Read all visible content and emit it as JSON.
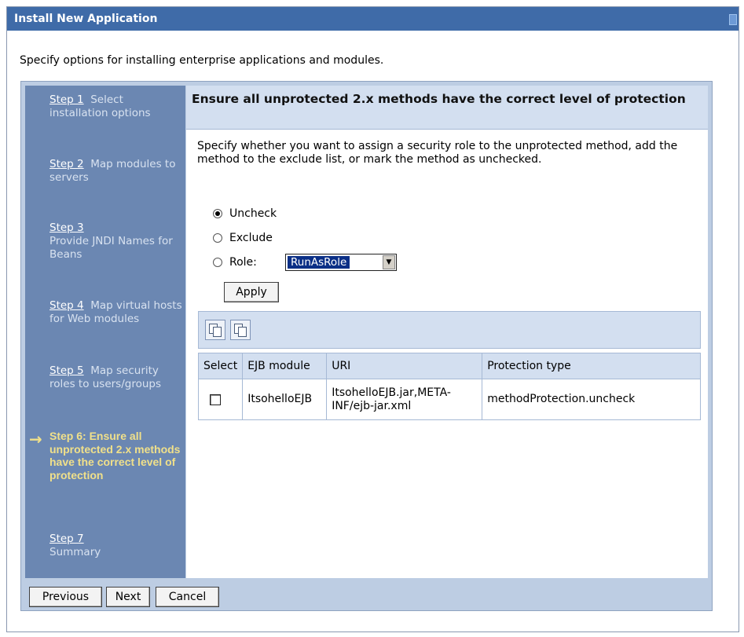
{
  "window": {
    "title": "Install New Application"
  },
  "intro": "Specify options for installing enterprise applications and modules.",
  "steps": [
    {
      "num": "Step 1",
      "text": "Select installation options"
    },
    {
      "num": "Step 2",
      "text": "Map modules to servers"
    },
    {
      "num": "Step 3",
      "text": "Provide JNDI Names for Beans"
    },
    {
      "num": "Step 4",
      "text": "Map virtual hosts for Web modules"
    },
    {
      "num": "Step 5",
      "text": "Map security roles to users/groups"
    },
    {
      "num": "Step 6:",
      "text": "Ensure all unprotected 2.x methods have the correct level of protection",
      "current": true
    },
    {
      "num": "Step 7",
      "text": "Summary"
    }
  ],
  "main": {
    "heading": "Ensure all unprotected 2.x methods have the correct level of protection",
    "description": "Specify whether you want to assign a security role to the unprotected method, add the method to the exclude list, or mark the method as unchecked.",
    "options": {
      "uncheck": "Uncheck",
      "exclude": "Exclude",
      "role": "Role:",
      "selected": "uncheck"
    },
    "role_select": {
      "value": "RunAsRole"
    },
    "apply_label": "Apply",
    "toolbar_icons": [
      "select-all-icon",
      "deselect-all-icon"
    ],
    "table": {
      "headers": [
        "Select",
        "EJB module",
        "URI",
        "Protection type"
      ],
      "rows": [
        {
          "selected": false,
          "ejb_module": "ItsohelloEJB",
          "uri": "ItsohelloEJB.jar,META-INF/ejb-jar.xml",
          "protection_type": "methodProtection.uncheck"
        }
      ]
    }
  },
  "footer": {
    "previous": "Previous",
    "next": "Next",
    "cancel": "Cancel"
  }
}
